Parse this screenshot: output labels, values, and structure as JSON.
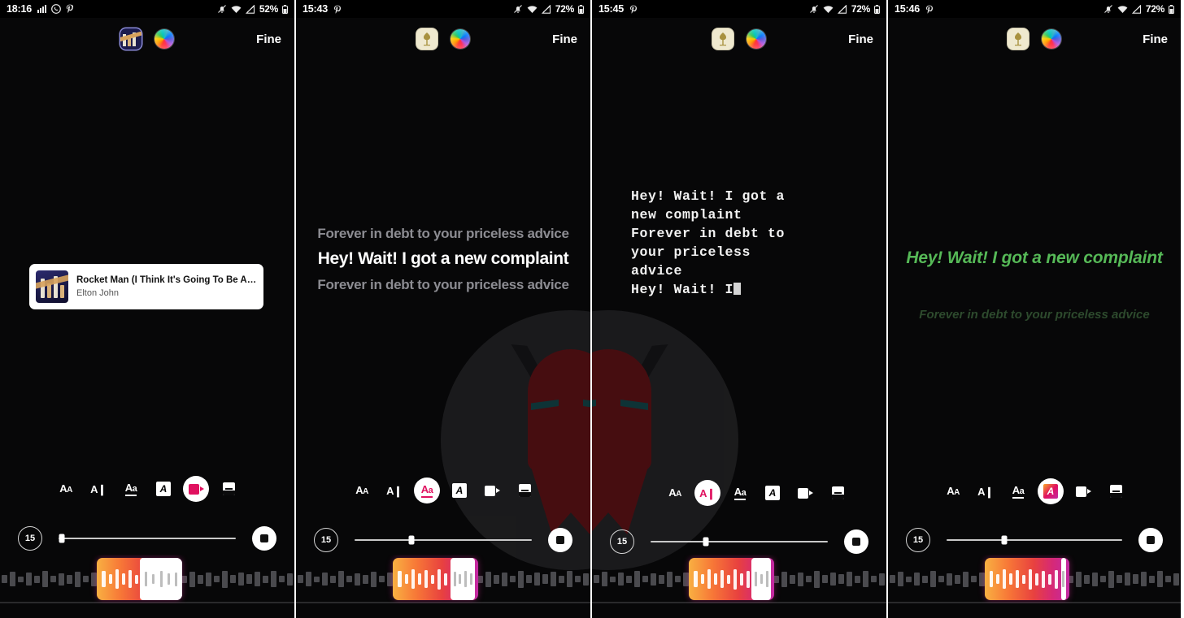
{
  "panels": [
    {
      "id": "panel-1",
      "status": {
        "clock": "18:16",
        "icons": [
          "signal-bars-icon",
          "whatsapp-icon",
          "pinterest-icon"
        ],
        "right_icons": [
          "bell-off-icon",
          "wifi-icon",
          "cellular-icon"
        ],
        "battery": "52%"
      },
      "appbar": {
        "app_icon": "album-thumb-icon",
        "color_icon": "color-wheel-icon",
        "right_label": "Fine"
      },
      "music": {
        "title": "Rocket Man (I Think It's Going To Be A…",
        "artist": "Elton John",
        "art": "rocket-man-album-art"
      },
      "toolbar": [
        {
          "name": "font-size-tool",
          "glyph": "AA",
          "selected": false
        },
        {
          "name": "text-align-tool",
          "glyph": "AI",
          "selected": false
        },
        {
          "name": "font-style-tool",
          "glyph": "Aa",
          "selected": false
        },
        {
          "name": "text-background-tool",
          "glyph": "A",
          "selected": false
        },
        {
          "name": "video-effect-tool",
          "glyph": "video",
          "selected": true
        },
        {
          "name": "card-layout-tool",
          "glyph": "card",
          "selected": false
        }
      ],
      "timer": {
        "badge": "15",
        "slider_percent": 2
      },
      "waveform": {
        "selection_left_percent": 33,
        "selection_width_percent": 29,
        "handle_offset_percent": 50
      }
    },
    {
      "id": "panel-2",
      "status": {
        "clock": "15:43",
        "icons": [
          "pinterest-icon"
        ],
        "right_icons": [
          "bell-off-icon",
          "wifi-icon",
          "cellular-icon"
        ],
        "battery": "72%"
      },
      "appbar": {
        "app_icon": "light-app-icon",
        "color_icon": "color-wheel-icon",
        "right_label": "Fine"
      },
      "lyrics": {
        "style": "bold-centered",
        "before": "Forever in debt to your priceless advice",
        "active": "Hey! Wait! I got a new complaint",
        "after": "Forever in debt to your priceless advice"
      },
      "toolbar": [
        {
          "name": "font-size-tool",
          "glyph": "AA",
          "selected": false
        },
        {
          "name": "text-align-tool",
          "glyph": "AI",
          "selected": false
        },
        {
          "name": "font-style-tool",
          "glyph": "Aa",
          "selected": true
        },
        {
          "name": "text-background-tool",
          "glyph": "A",
          "selected": false
        },
        {
          "name": "video-effect-tool",
          "glyph": "video",
          "selected": false
        },
        {
          "name": "card-layout-tool",
          "glyph": "card",
          "selected": false
        }
      ],
      "timer": {
        "badge": "15",
        "slider_percent": 32
      },
      "waveform": {
        "selection_left_percent": 33,
        "selection_width_percent": 29,
        "handle_offset_percent": 67
      }
    },
    {
      "id": "panel-3",
      "status": {
        "clock": "15:45",
        "icons": [
          "pinterest-icon"
        ],
        "right_icons": [
          "bell-off-icon",
          "wifi-icon",
          "cellular-icon"
        ],
        "battery": "72%"
      },
      "appbar": {
        "app_icon": "light-app-icon",
        "color_icon": "color-wheel-icon",
        "right_label": "Fine"
      },
      "lyrics": {
        "style": "monospace-typed",
        "text": "Hey! Wait! I got a\nnew complaint\nForever in debt to\nyour priceless\nadvice\nHey! Wait! I",
        "caret": true
      },
      "toolbar": [
        {
          "name": "font-size-tool",
          "glyph": "AA",
          "selected": false
        },
        {
          "name": "text-align-tool",
          "glyph": "AI",
          "selected": true
        },
        {
          "name": "font-style-tool",
          "glyph": "Aa",
          "selected": false
        },
        {
          "name": "text-background-tool",
          "glyph": "A",
          "selected": false
        },
        {
          "name": "video-effect-tool",
          "glyph": "video",
          "selected": false
        },
        {
          "name": "card-layout-tool",
          "glyph": "card",
          "selected": false
        }
      ],
      "timer": {
        "badge": "15",
        "slider_percent": 31
      },
      "waveform": {
        "selection_left_percent": 33,
        "selection_width_percent": 29,
        "handle_offset_percent": 73
      }
    },
    {
      "id": "panel-4",
      "status": {
        "clock": "15:46",
        "icons": [
          "pinterest-icon"
        ],
        "right_icons": [
          "bell-off-icon",
          "wifi-icon",
          "cellular-icon"
        ],
        "battery": "72%"
      },
      "appbar": {
        "app_icon": "light-app-icon",
        "color_icon": "color-wheel-icon",
        "right_label": "Fine"
      },
      "lyrics": {
        "style": "green-italic",
        "active": "Hey! Wait! I got a new complaint",
        "after": "Forever in debt to your priceless advice"
      },
      "toolbar": [
        {
          "name": "font-size-tool",
          "glyph": "AA",
          "selected": false
        },
        {
          "name": "text-align-tool",
          "glyph": "AI",
          "selected": false
        },
        {
          "name": "font-style-tool",
          "glyph": "Aa",
          "selected": false
        },
        {
          "name": "text-background-tool",
          "glyph": "A",
          "selected": true
        },
        {
          "name": "video-effect-tool",
          "glyph": "video",
          "selected": false
        },
        {
          "name": "card-layout-tool",
          "glyph": "card",
          "selected": false
        }
      ],
      "timer": {
        "badge": "15",
        "slider_percent": 33
      },
      "waveform": {
        "selection_left_percent": 33,
        "selection_width_percent": 29,
        "handle_offset_percent": 90
      }
    }
  ],
  "colors": {
    "accent_pink": "#e0115f",
    "gradient_start": "#f9b042",
    "gradient_end": "#c32aa3",
    "lyric_green": "#56b957",
    "lyric_dim": "#8c8c92",
    "background": "#070708"
  }
}
